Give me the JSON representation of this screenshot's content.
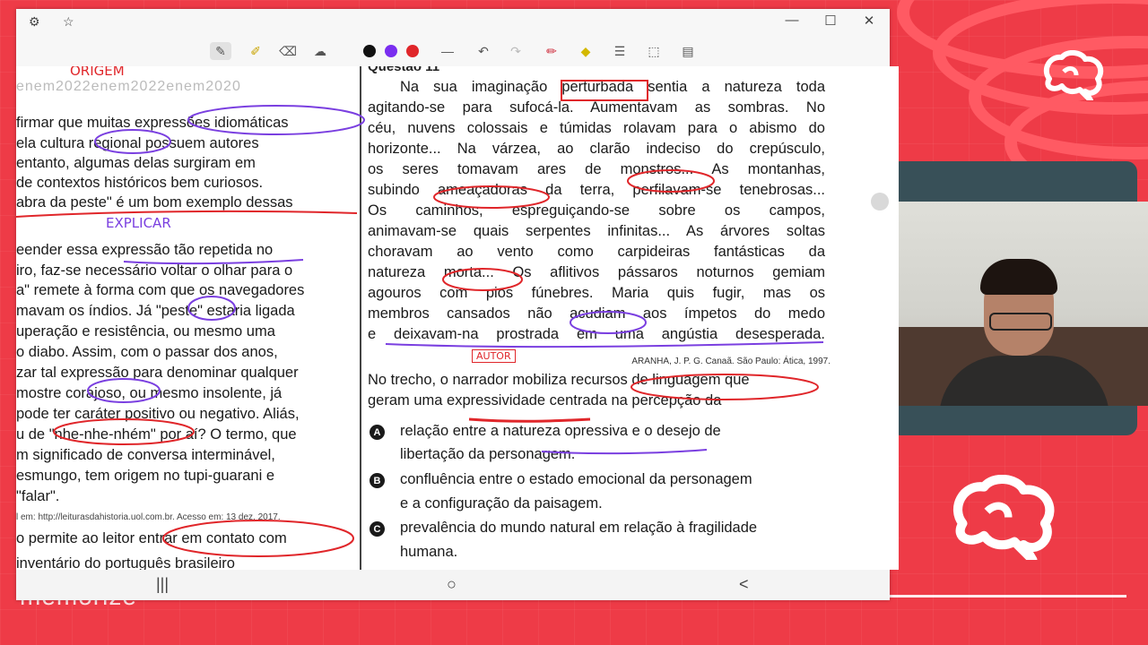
{
  "brand": {
    "name": "memorize",
    "accent": "#ee3b47"
  },
  "window": {
    "controls": {
      "minimize": "—",
      "maximize": "☐",
      "close": "✕"
    },
    "icons": [
      "settings-icon",
      "star-icon"
    ]
  },
  "toolbar": {
    "tools": [
      "pen-icon",
      "highlighter-icon",
      "eraser-icon",
      "lasso-icon"
    ],
    "colors": [
      "#111111",
      "#7a2ef0",
      "#e0262a"
    ],
    "actions": [
      "line-icon",
      "undo-icon",
      "redo-icon",
      "marker-icon",
      "shape-icon",
      "text-icon",
      "image-icon",
      "page-icon"
    ]
  },
  "left_page": {
    "header": "enem2022enem2022enem2020",
    "lines": [
      "firmar que muitas expressões idiomáticas",
      "ela cultura regional possuem autores",
      "entanto, algumas delas surgiram em",
      "de contextos históricos bem curiosos.",
      "abra da peste\" é um bom exemplo dessas",
      "eender essa expressão tão repetida no",
      "iro, faz-se necessário voltar o olhar para o",
      "a\" remete à forma com que os navegadores",
      "mavam os índios. Já \"peste\" estaria ligada",
      "uperação e resistência, ou mesmo uma",
      "o diabo. Assim, com o passar dos anos,",
      "zar tal expressão para denominar qualquer",
      "mostre corajoso, ou mesmo insolente, já",
      "pode ter caráter positivo ou negativo. Aliás,",
      "u de \"nhe-nhe-nhém\" por aí? O termo, que",
      "m significado de conversa interminável,",
      "esmungo, tem origem no tupi-guarani e",
      "\"falar\"."
    ],
    "source": "l em: http://leiturasdahistoria.uol.com.br. Acesso em: 13 dez. 2017.",
    "bottom_lines": [
      "o permite ao leitor entrar em contato com",
      "inventário do português brasileiro"
    ]
  },
  "right_page": {
    "question_label": "Questão 11",
    "passage": [
      "Na sua imaginação perturbada sentia a natureza toda",
      "agitando-se para sufocá-la. Aumentavam as sombras. No",
      "céu, nuvens colossais e túmidas rolavam para o abismo do",
      "horizonte... Na várzea, ao clarão indeciso do crepúsculo,",
      "os seres tomavam ares de monstros... As montanhas,",
      "subindo ameaçadoras da terra, perfilavam-se tenebrosas...",
      "Os caminhos, espreguiçando-se sobre os campos,",
      "animavam-se quais serpentes infinitas... As árvores soltas",
      "choravam ao vento como carpideiras fantásticas da",
      "natureza morta... Os aflitivos pássaros noturnos gemiam",
      "agouros com pios fúnebres. Maria quis fugir, mas os",
      "membros cansados não acudiam aos ímpetos do medo",
      "e deixavam-na prostrada em uma angústia desesperada."
    ],
    "citation": "ARANHA, J. P. G. Canaã. São Paulo: Ática, 1997.",
    "stem": [
      "No trecho, o narrador mobiliza recursos de linguagem que",
      "geram uma expressividade centrada na percepção da"
    ],
    "options": [
      {
        "letter": "A",
        "lines": [
          "relação entre a natureza opressiva e o desejo de",
          "libertação da personagem."
        ]
      },
      {
        "letter": "B",
        "lines": [
          "confluência entre o estado emocional da personagem",
          "e a configuração da paisagem."
        ]
      },
      {
        "letter": "C",
        "lines": [
          "prevalência do mundo natural em relação à fragilidade",
          "humana."
        ]
      }
    ]
  },
  "annotations": {
    "origem": "ORIGEM",
    "explicar": "EXPLICAR",
    "autor": "AUTOR"
  },
  "nav": {
    "recent": "|||",
    "home": "○",
    "back": "<"
  }
}
